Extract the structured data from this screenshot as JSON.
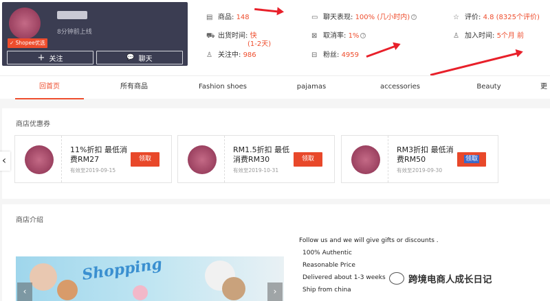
{
  "shop": {
    "online_status": "8分钟前上线",
    "badge": "Shopee优选",
    "follow_label": "关注",
    "chat_label": "聊天"
  },
  "stats": {
    "products": {
      "label": "商品:",
      "value": "148"
    },
    "chat_performance": {
      "label": "聊天表现:",
      "value": "100% (几小时内)"
    },
    "rating": {
      "label": "评价:",
      "value": "4.8 (8325个评价)"
    },
    "ship_time": {
      "label": "出货时间:",
      "value": "快",
      "value2": "(1-2天)"
    },
    "cancel_rate": {
      "label": "取消率:",
      "value": "1%"
    },
    "joined": {
      "label": "加入时间:",
      "value": "5个月 前"
    },
    "following": {
      "label": "关注中:",
      "value": "986"
    },
    "followers": {
      "label": "粉丝:",
      "value": "4959"
    }
  },
  "tabs": [
    "回首页",
    "所有商品",
    "Fashion shoes",
    "pajamas",
    "accessories",
    "Beauty",
    "更"
  ],
  "vouchers": {
    "title": "商店优惠券",
    "items": [
      {
        "text": "11%折扣 最低消费RM27",
        "valid": "有效至2019-09-15",
        "button": "领取"
      },
      {
        "text": "RM1.5折扣 最低消费RM30",
        "valid": "有效至2019-10-31",
        "button": "领取"
      },
      {
        "text": "RM3折扣 最低消费RM50",
        "valid": "有效至2019-09-30",
        "button": "领取"
      }
    ]
  },
  "intro": {
    "title": "商店介绍",
    "lines": [
      "Follow us and we will give gifts or discounts .",
      "100% Authentic",
      "Reasonable Price",
      "Delivered about 1-3 weeks",
      "Ship from china"
    ],
    "banner_word": "Shopping"
  },
  "watermark": "跨境电商人成长日记",
  "colors": {
    "accent": "#ee4d2d",
    "card_bg": "#3b3d52",
    "arrow": "#e8202a"
  }
}
